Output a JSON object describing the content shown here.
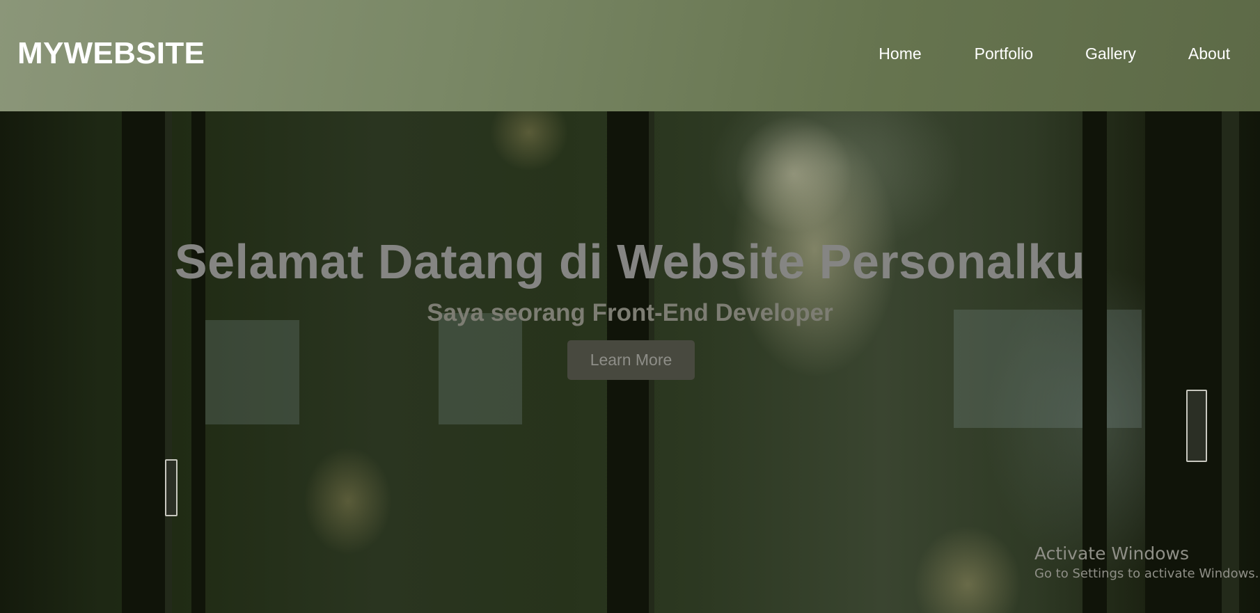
{
  "header": {
    "logo": "MYWEBSITE",
    "nav": [
      {
        "label": "Home"
      },
      {
        "label": "Portfolio"
      },
      {
        "label": "Gallery"
      },
      {
        "label": "About"
      }
    ]
  },
  "hero": {
    "title": "Selamat Datang di Website Personalku",
    "subtitle": "Saya seorang Front-End Developer",
    "button_label": "Learn More"
  },
  "watermark": {
    "title": "Activate Windows",
    "subtitle": "Go to Settings to activate Windows."
  },
  "colors": {
    "header_bg": "#7a8866",
    "button_bg": "#48493f",
    "text_white": "#ffffff"
  }
}
